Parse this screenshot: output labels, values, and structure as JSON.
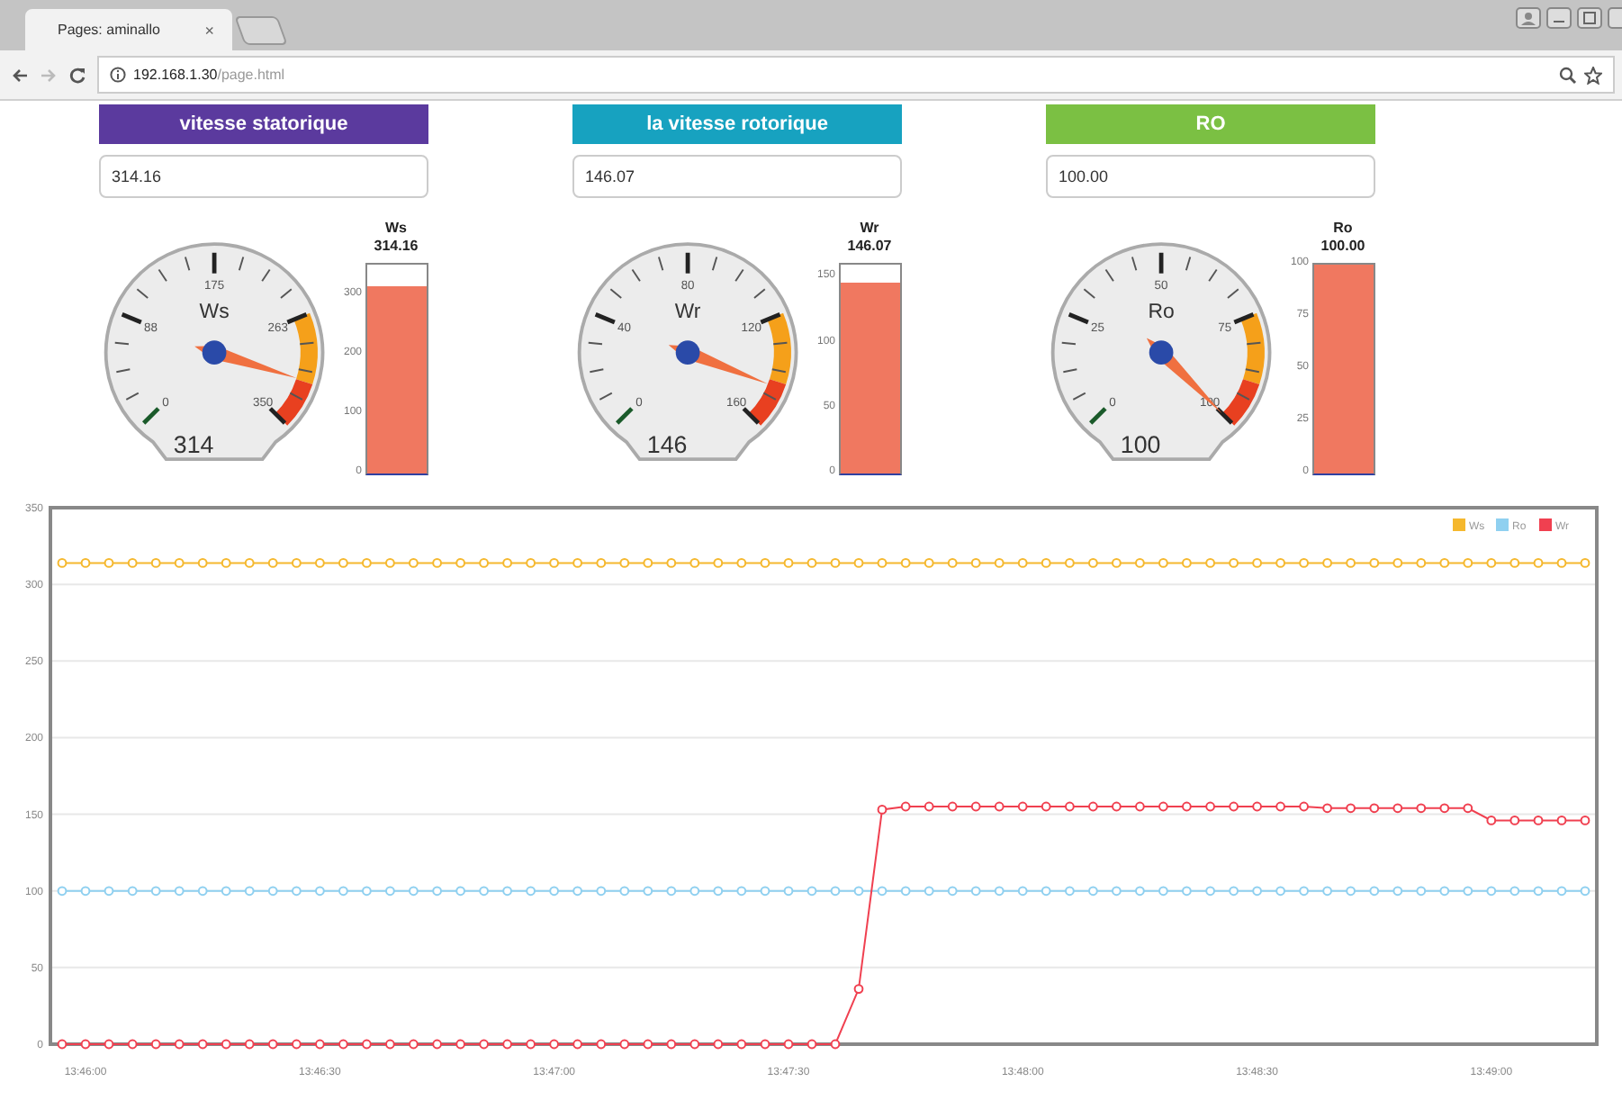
{
  "browser": {
    "tab": {
      "title": "Pages: aminallo",
      "close": "×"
    },
    "address": {
      "host": "192.168.1.30",
      "path": "/page.html"
    }
  },
  "panels": [
    {
      "title": "vitesse statorique",
      "color": "#5b3a9e",
      "value": "314.16",
      "gauge": {
        "label": "Ws",
        "scale": [
          "0",
          "88",
          "175",
          "263",
          "350"
        ],
        "readout": "314"
      },
      "bar": {
        "label": "Ws",
        "value": "314.16",
        "ticks": [
          "300",
          "200",
          "100",
          "0"
        ],
        "level": 0.8976
      }
    },
    {
      "title": "la vitesse rotorique",
      "color": "#17a2c0",
      "value": "146.07",
      "gauge": {
        "label": "Wr",
        "scale": [
          "0",
          "40",
          "80",
          "120",
          "160"
        ],
        "readout": "146"
      },
      "bar": {
        "label": "Wr",
        "value": "146.07",
        "ticks": [
          "150",
          "100",
          "50",
          "0"
        ],
        "level": 0.9129
      }
    },
    {
      "title": "RO",
      "color": "#7bc043",
      "value": "100.00",
      "gauge": {
        "label": "Ro",
        "scale": [
          "0",
          "25",
          "50",
          "75",
          "100"
        ],
        "readout": "100"
      },
      "bar": {
        "label": "Ro",
        "value": "100.00",
        "ticks": [
          "100",
          "75",
          "50",
          "25",
          "0"
        ],
        "level": 1.0
      }
    }
  ],
  "chart": {
    "chart_data": {
      "type": "line",
      "categories": [
        null,
        "13:46:00",
        null,
        null,
        null,
        null,
        null,
        null,
        null,
        null,
        null,
        "13:46:30",
        null,
        null,
        null,
        null,
        null,
        null,
        null,
        null,
        null,
        "13:47:00",
        null,
        null,
        null,
        null,
        null,
        null,
        null,
        null,
        null,
        "13:47:30",
        null,
        null,
        null,
        null,
        null,
        null,
        null,
        null,
        null,
        "13:48:00",
        null,
        null,
        null,
        null,
        null,
        null,
        null,
        null,
        null,
        "13:48:30",
        null,
        null,
        null,
        null,
        null,
        null,
        null,
        null,
        null,
        "13:49:00",
        null,
        null,
        null,
        null
      ],
      "ylim": [
        0,
        350
      ],
      "grid": true,
      "legend": true,
      "yticks": [
        0,
        50,
        100,
        150,
        200,
        250,
        300,
        350
      ],
      "series": [
        {
          "name": "Ws",
          "color": "#f5b82e",
          "values": [
            314,
            314,
            314,
            314,
            314,
            314,
            314,
            314,
            314,
            314,
            314,
            314,
            314,
            314,
            314,
            314,
            314,
            314,
            314,
            314,
            314,
            314,
            314,
            314,
            314,
            314,
            314,
            314,
            314,
            314,
            314,
            314,
            314,
            314,
            314,
            314,
            314,
            314,
            314,
            314,
            314,
            314,
            314,
            314,
            314,
            314,
            314,
            314,
            314,
            314,
            314,
            314,
            314,
            314,
            314,
            314,
            314,
            314,
            314,
            314,
            314,
            314,
            314,
            314,
            314,
            314
          ]
        },
        {
          "name": "Ro",
          "color": "#8fd0f0",
          "values": [
            100,
            100,
            100,
            100,
            100,
            100,
            100,
            100,
            100,
            100,
            100,
            100,
            100,
            100,
            100,
            100,
            100,
            100,
            100,
            100,
            100,
            100,
            100,
            100,
            100,
            100,
            100,
            100,
            100,
            100,
            100,
            100,
            100,
            100,
            100,
            100,
            100,
            100,
            100,
            100,
            100,
            100,
            100,
            100,
            100,
            100,
            100,
            100,
            100,
            100,
            100,
            100,
            100,
            100,
            100,
            100,
            100,
            100,
            100,
            100,
            100,
            100,
            100,
            100,
            100,
            100
          ]
        },
        {
          "name": "Wr",
          "color": "#f04050",
          "values": [
            0,
            0,
            0,
            0,
            0,
            0,
            0,
            0,
            0,
            0,
            0,
            0,
            0,
            0,
            0,
            0,
            0,
            0,
            0,
            0,
            0,
            0,
            0,
            0,
            0,
            0,
            0,
            0,
            0,
            0,
            0,
            0,
            0,
            0,
            36,
            153,
            155,
            155,
            155,
            155,
            155,
            155,
            155,
            155,
            155,
            155,
            155,
            155,
            155,
            155,
            155,
            155,
            155,
            155,
            154,
            154,
            154,
            154,
            154,
            154,
            154,
            146,
            146,
            146,
            146,
            146
          ]
        }
      ]
    }
  }
}
